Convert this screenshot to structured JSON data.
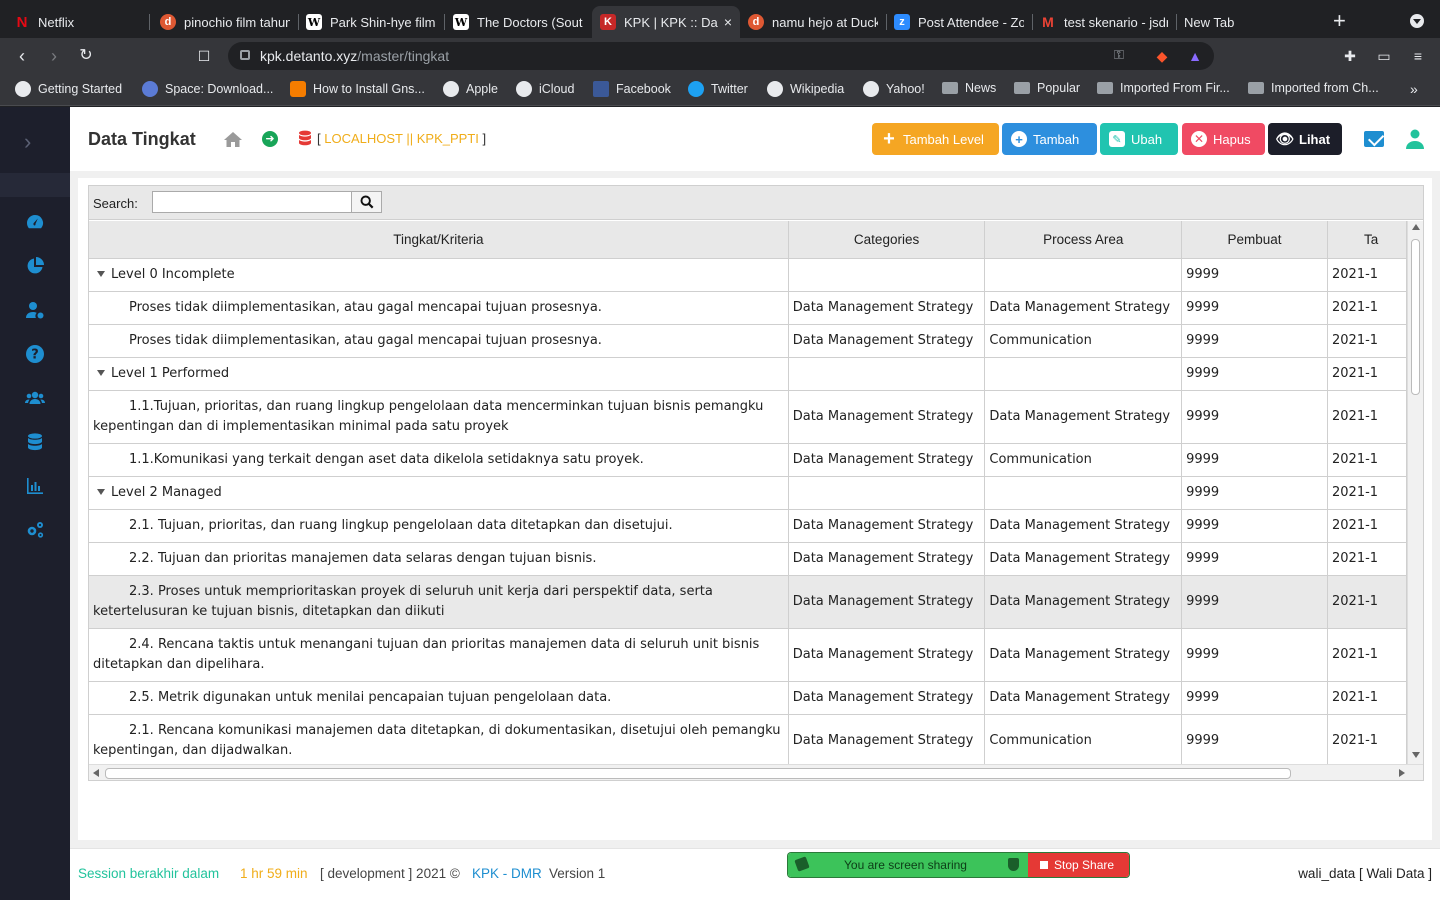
{
  "browser": {
    "tabs": [
      {
        "title": "Netflix",
        "icon": "netflix-icon",
        "fav_color": "#e50914",
        "fav_glyph": "N"
      },
      {
        "title": "pinochio film tahun",
        "icon": "duckduckgo-icon",
        "fav_color": "#de5833",
        "fav_glyph": "d"
      },
      {
        "title": "Park Shin-hye filmo",
        "icon": "wikipedia-icon",
        "fav_color": "#ffffff",
        "fav_glyph": "W"
      },
      {
        "title": "The Doctors (South",
        "icon": "wikipedia-icon",
        "fav_color": "#ffffff",
        "fav_glyph": "W"
      },
      {
        "title": "KPK | KPK :: Dat",
        "icon": "kpk-icon",
        "fav_color": "#c62828",
        "fav_glyph": "K"
      },
      {
        "title": "namu hejo at Duck",
        "icon": "duckduckgo-icon",
        "fav_color": "#de5833",
        "fav_glyph": "d"
      },
      {
        "title": "Post Attendee - Zo",
        "icon": "zoom-icon",
        "fav_color": "#2d8cff",
        "fav_glyph": "z"
      },
      {
        "title": "test skenario - jsdr",
        "icon": "gmail-icon",
        "fav_color": "#ea4335",
        "fav_glyph": "M"
      },
      {
        "title": "New Tab",
        "icon": "newtab-icon",
        "fav_color": "",
        "fav_glyph": ""
      }
    ],
    "active_tab_close": "×",
    "new_tab": "+",
    "url_host": "kpk.detanto.xyz",
    "url_path": "/master/tingkat",
    "bookmarks": [
      {
        "label": "Getting Started",
        "icon": "globe-icon"
      },
      {
        "label": "Space: Download...",
        "icon": "space-icon"
      },
      {
        "label": "How to Install Gns...",
        "icon": "blogger-icon"
      },
      {
        "label": "Apple",
        "icon": "globe-icon"
      },
      {
        "label": "iCloud",
        "icon": "globe-icon"
      },
      {
        "label": "Facebook",
        "icon": "facebook-icon"
      },
      {
        "label": "Twitter",
        "icon": "twitter-icon"
      },
      {
        "label": "Wikipedia",
        "icon": "globe-icon"
      },
      {
        "label": "Yahoo!",
        "icon": "globe-icon"
      },
      {
        "label": "News",
        "icon": "folder-icon"
      },
      {
        "label": "Popular",
        "icon": "folder-icon"
      },
      {
        "label": "Imported From Fir...",
        "icon": "folder-icon"
      },
      {
        "label": "Imported from Ch...",
        "icon": "folder-icon"
      }
    ],
    "bookmarks_more": "»"
  },
  "header": {
    "title": "Data Tingkat",
    "connection_open": "[",
    "connection": "LOCALHOST || KPK_PPTI",
    "connection_close": "]",
    "buttons": {
      "add_level": "Tambah Level",
      "add": "Tambah",
      "edit": "Ubah",
      "delete": "Hapus",
      "view": "Lihat"
    }
  },
  "grid": {
    "search_label": "Search:",
    "search_value": "",
    "columns": [
      "Tingkat/Kriteria",
      "Categories",
      "Process Area",
      "Pembuat",
      "Ta"
    ],
    "rows": [
      {
        "type": "level",
        "criteria": "Level 0 Incomplete",
        "category": "",
        "process_area": "",
        "creator": "9999",
        "date": "2021-1"
      },
      {
        "type": "item",
        "criteria": "Proses tidak diimplementasikan, atau gagal mencapai tujuan prosesnya.",
        "category": "Data Management Strategy",
        "process_area": "Data Management Strategy",
        "creator": "9999",
        "date": "2021-1"
      },
      {
        "type": "item",
        "criteria": "Proses tidak diimplementasikan, atau gagal mencapai tujuan prosesnya.",
        "category": "Data Management Strategy",
        "process_area": "Communication",
        "creator": "9999",
        "date": "2021-1"
      },
      {
        "type": "level",
        "criteria": "Level 1 Performed",
        "category": "",
        "process_area": "",
        "creator": "9999",
        "date": "2021-1"
      },
      {
        "type": "item",
        "criteria": "1.1.Tujuan, prioritas, dan ruang lingkup pengelolaan data mencerminkan tujuan bisnis pemangku kepentingan dan di implementasikan minimal pada satu proyek",
        "category": "Data Management Strategy",
        "process_area": "Data Management Strategy",
        "creator": "9999",
        "date": "2021-1"
      },
      {
        "type": "item",
        "criteria": "1.1.Komunikasi yang terkait dengan aset data dikelola setidaknya satu proyek.",
        "category": "Data Management Strategy",
        "process_area": "Communication",
        "creator": "9999",
        "date": "2021-1"
      },
      {
        "type": "level",
        "criteria": "Level 2 Managed",
        "category": "",
        "process_area": "",
        "creator": "9999",
        "date": "2021-1"
      },
      {
        "type": "item",
        "criteria": "2.1. Tujuan, prioritas, dan ruang lingkup pengelolaan data ditetapkan dan disetujui.",
        "category": "Data Management Strategy",
        "process_area": "Data Management Strategy",
        "creator": "9999",
        "date": "2021-1"
      },
      {
        "type": "item",
        "criteria": "2.2. Tujuan dan prioritas manajemen data selaras dengan tujuan bisnis.",
        "category": "Data Management Strategy",
        "process_area": "Data Management Strategy",
        "creator": "9999",
        "date": "2021-1"
      },
      {
        "type": "item",
        "selected": true,
        "criteria": "2.3. Proses untuk memprioritaskan proyek di seluruh unit kerja dari perspektif data, serta ketertelusuran ke tujuan bisnis, ditetapkan dan diikuti",
        "category": "Data Management Strategy",
        "process_area": "Data Management Strategy",
        "creator": "9999",
        "date": "2021-1"
      },
      {
        "type": "item",
        "criteria": "2.4. Rencana taktis untuk menangani tujuan dan prioritas manajemen data di seluruh unit bisnis ditetapkan dan dipelihara.",
        "category": "Data Management Strategy",
        "process_area": "Data Management Strategy",
        "creator": "9999",
        "date": "2021-1"
      },
      {
        "type": "item",
        "criteria": "2.5. Metrik digunakan untuk menilai pencapaian tujuan pengelolaan data.",
        "category": "Data Management Strategy",
        "process_area": "Data Management Strategy",
        "creator": "9999",
        "date": "2021-1"
      },
      {
        "type": "item",
        "criteria": "2.1. Rencana komunikasi manajemen data ditetapkan, di dokumentasikan, disetujui oleh pemangku kepentingan, dan dijadwalkan.",
        "category": "Data Management Strategy",
        "process_area": "Communication",
        "creator": "9999",
        "date": "2021-1"
      }
    ]
  },
  "footer": {
    "session_label": "Session berakhir dalam",
    "session_time": "1 hr 59 min",
    "env": "[ development ] 2021 ©",
    "brand": "KPK - DMR",
    "version": "Version 1",
    "user": "wali_data [ Wali Data ]"
  },
  "screen_share": {
    "message": "You are screen sharing",
    "stop_label": "Stop Share"
  },
  "colors": {
    "accent": "#1e8ed0",
    "sidebar": "#1d1f2c",
    "orange": "#f5a623",
    "teal": "#21c4b0",
    "red": "#f04a63"
  }
}
